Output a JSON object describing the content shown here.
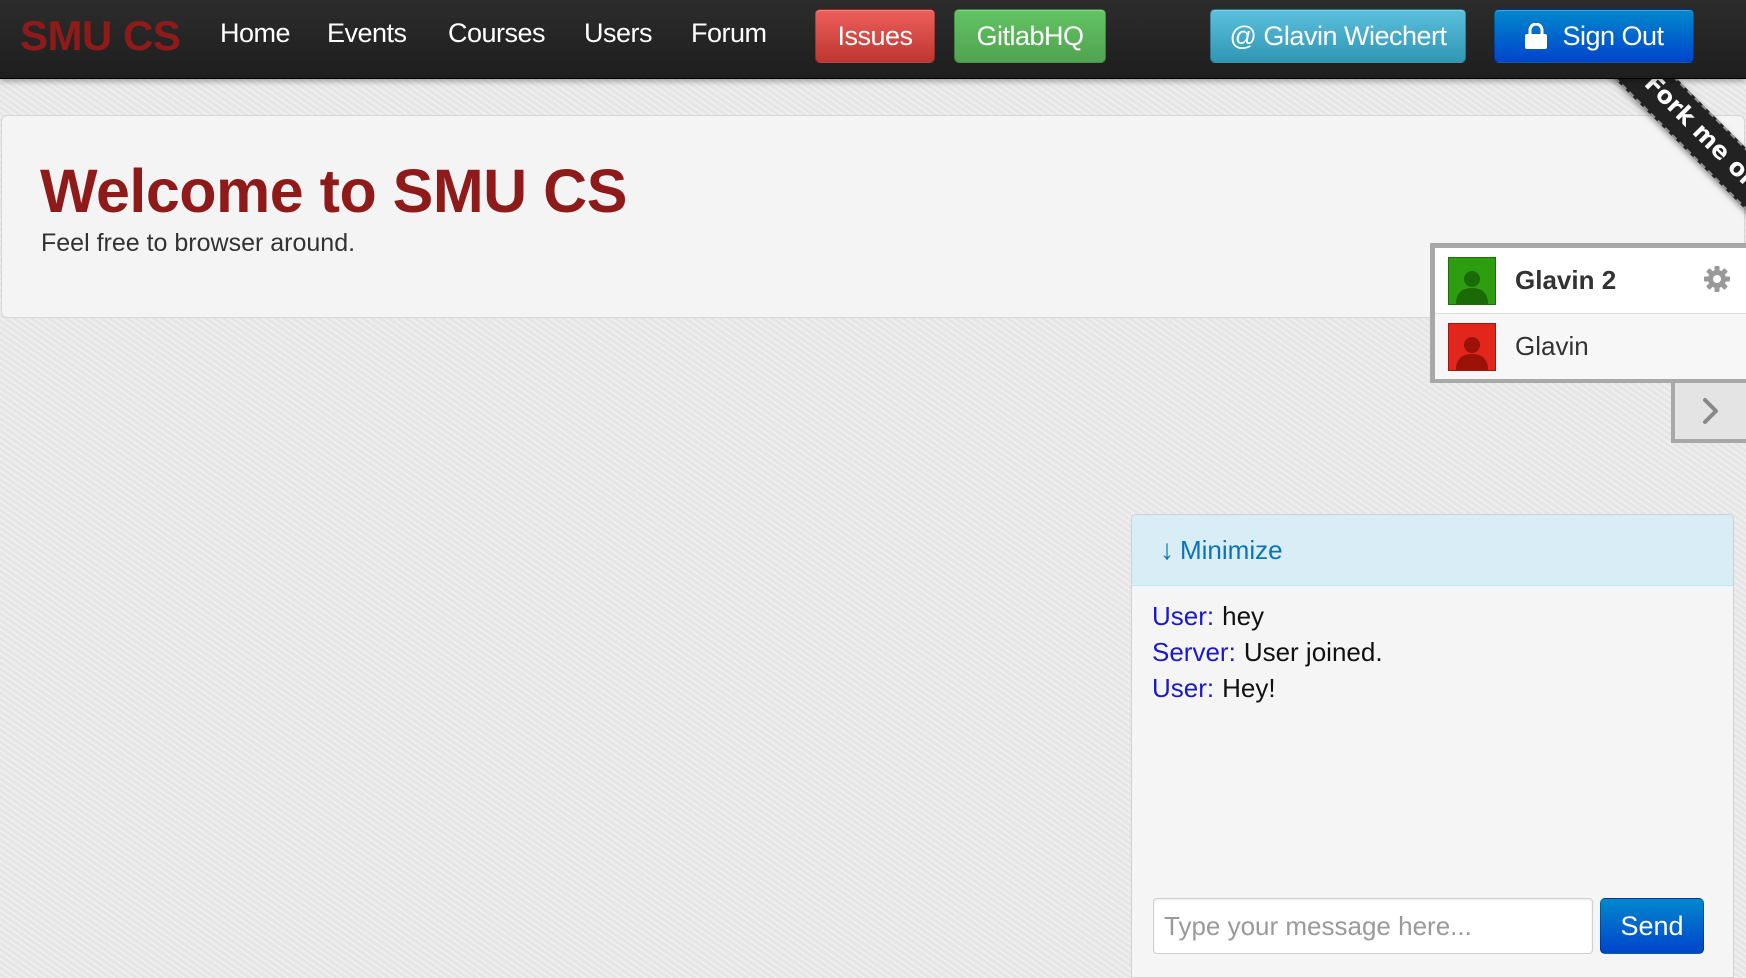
{
  "navbar": {
    "brand": "SMU CS",
    "links": [
      "Home",
      "Events",
      "Courses",
      "Users",
      "Forum"
    ],
    "issues_label": "Issues",
    "gitlab_label": "GitlabHQ",
    "user_label": "@ Glavin Wiechert",
    "signout_label": "Sign Out"
  },
  "hero": {
    "title": "Welcome to SMU CS",
    "subtitle": "Feel free to browser around."
  },
  "ribbon": {
    "text": "Fork me on GitH"
  },
  "userlist": {
    "users": [
      {
        "name": "Glavin 2",
        "status_color": "#2e9e10",
        "icon": "user-icon"
      },
      {
        "name": "Glavin",
        "status_color": "#e3261c",
        "icon": "user-icon"
      }
    ],
    "settings_icon": "gear-icon",
    "collapse_icon": "chevron-right-icon"
  },
  "chat": {
    "minimize_label": "Minimize",
    "minimize_icon": "↓",
    "messages": [
      {
        "author": "User:",
        "text": "hey"
      },
      {
        "author": "Server:",
        "text": "User joined."
      },
      {
        "author": "User:",
        "text": "Hey!"
      }
    ],
    "input_placeholder": "Type your message here...",
    "input_value": "",
    "send_label": "Send"
  },
  "colors": {
    "brand": "#8e1a1a",
    "navbar_bg": "#222222",
    "danger": "#da4f49",
    "success": "#5bb75b",
    "info": "#49afcd",
    "primary": "#006dcc",
    "message_author": "#1a1acc"
  }
}
